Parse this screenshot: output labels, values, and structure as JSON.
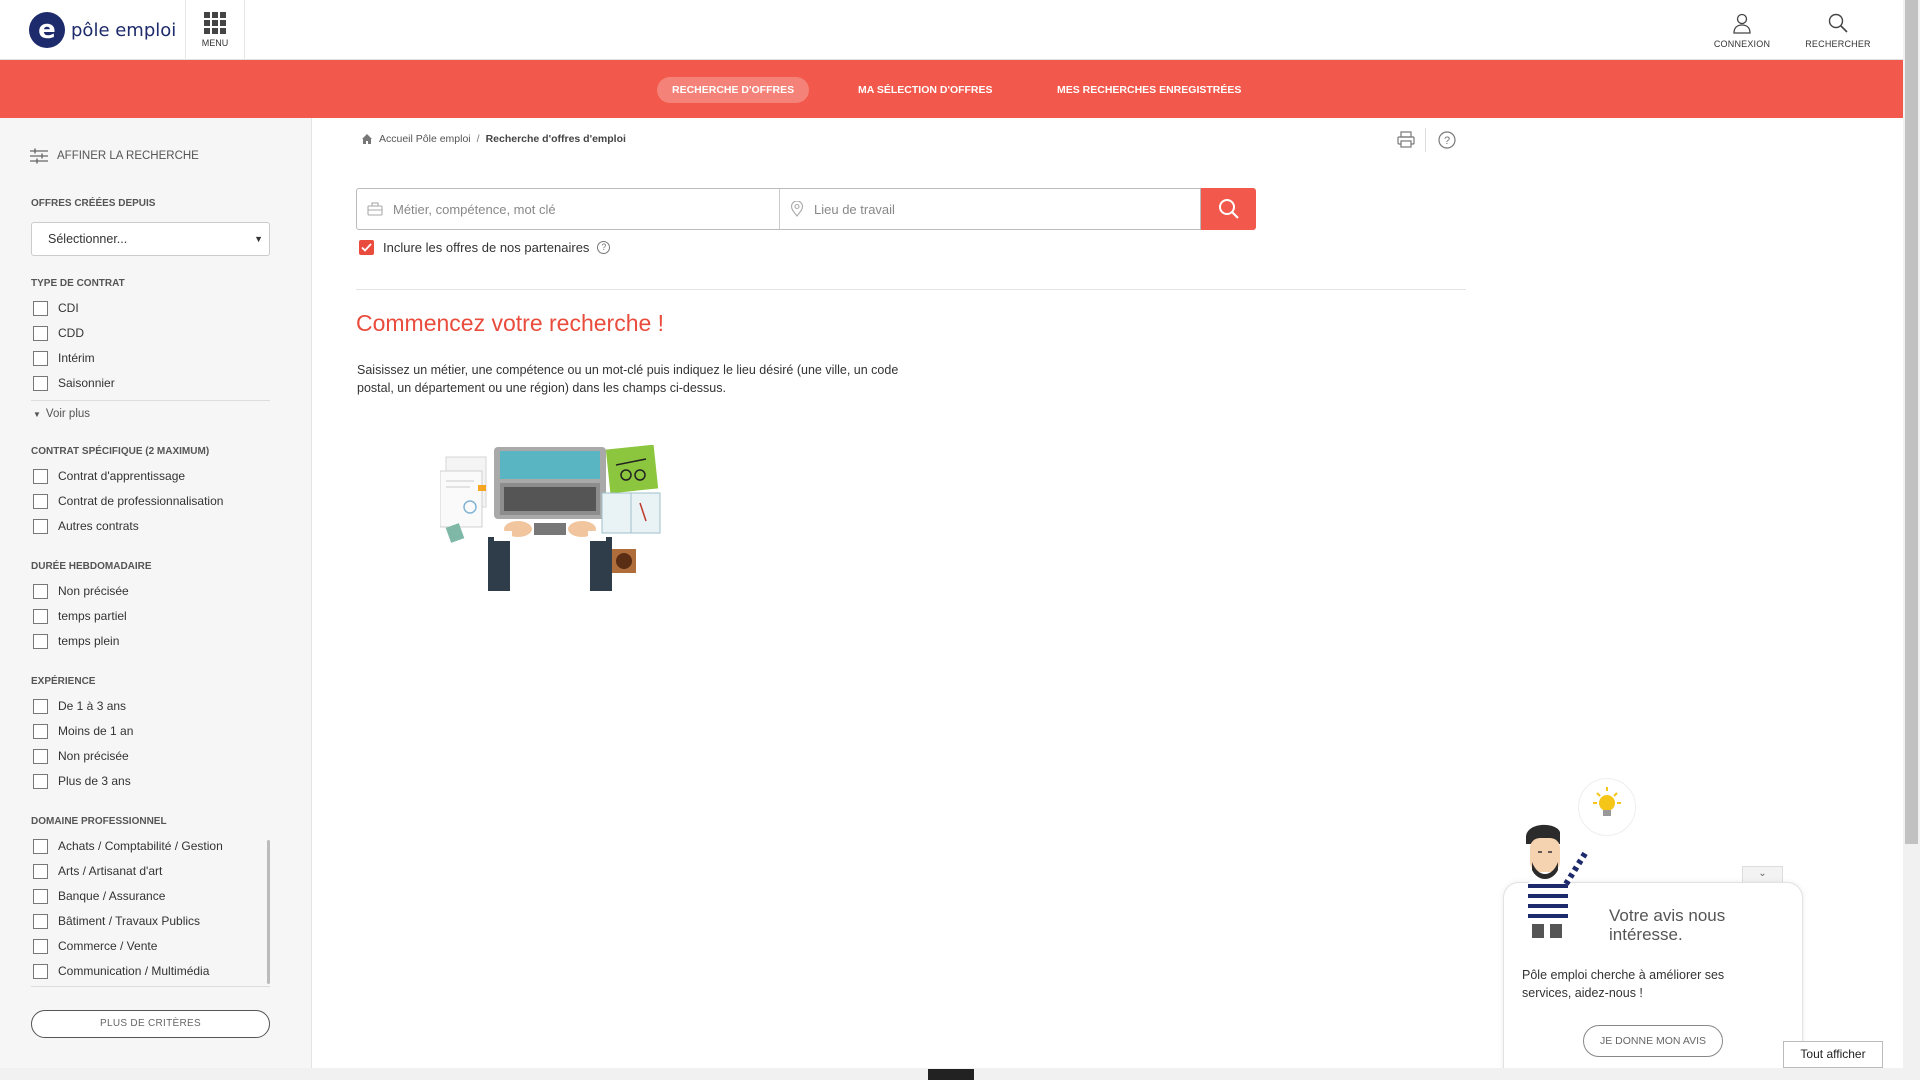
{
  "header": {
    "logo_letter": "e",
    "logo_text": "pôle emploi",
    "menu_label": "MENU",
    "connexion_label": "CONNEXION",
    "rechercher_label": "RECHERCHER"
  },
  "nav": {
    "tabs": [
      {
        "label": "RECHERCHE D'OFFRES",
        "active": true
      },
      {
        "label": "MA SÉLECTION D'OFFRES",
        "active": false
      },
      {
        "label": "MES RECHERCHES ENREGISTRÉES",
        "active": false
      }
    ]
  },
  "sidebar": {
    "title": "AFFINER LA RECHERCHE",
    "offres_since": {
      "label": "OFFRES CRÉÉES DEPUIS",
      "selected": "Sélectionner..."
    },
    "contrat": {
      "label": "TYPE DE CONTRAT",
      "items": [
        "CDI",
        "CDD",
        "Intérim",
        "Saisonnier"
      ],
      "voir_plus": "Voir plus"
    },
    "specifique": {
      "label": "CONTRAT SPÉCIFIQUE (2 MAXIMUM)",
      "items": [
        "Contrat d'apprentissage",
        "Contrat de professionnalisation",
        "Autres contrats"
      ]
    },
    "duree": {
      "label": "DURÉE HEBDOMADAIRE",
      "items": [
        "Non précisée",
        "temps partiel",
        "temps plein"
      ]
    },
    "experience": {
      "label": "EXPÉRIENCE",
      "items": [
        "De 1 à 3 ans",
        "Moins de 1 an",
        "Non précisée",
        "Plus de 3 ans"
      ]
    },
    "domaine": {
      "label": "DOMAINE PROFESSIONNEL",
      "items": [
        "Achats / Comptabilité / Gestion",
        "Arts / Artisanat d'art",
        "Banque / Assurance",
        "Bâtiment / Travaux Publics",
        "Commerce / Vente",
        "Communication / Multimédia"
      ]
    },
    "plus_criteres": "PLUS DE CRITÈRES"
  },
  "breadcrumb": {
    "home": "Accueil Pôle emploi",
    "separator": "/",
    "current": "Recherche d'offres d'emploi"
  },
  "search": {
    "metier_placeholder": "Métier, compétence, mot clé",
    "lieu_placeholder": "Lieu de travail",
    "partners_label": "Inclure les offres de nos partenaires",
    "partners_checked": true
  },
  "main": {
    "heading": "Commencez votre recherche !",
    "intro": "Saisissez un métier, une compétence ou un mot-clé puis indiquez le lieu désiré (une ville, un code postal, un département ou une région) dans les champs ci-dessus."
  },
  "feedback": {
    "title": "Votre avis nous intéresse.",
    "text": "Pôle emploi cherche à améliorer ses services, aidez-nous !",
    "button": "JE DONNE MON AVIS",
    "show_all": "Tout afficher"
  },
  "colors": {
    "brand_red": "#f2584b",
    "brand_navy": "#1d2a6b"
  }
}
